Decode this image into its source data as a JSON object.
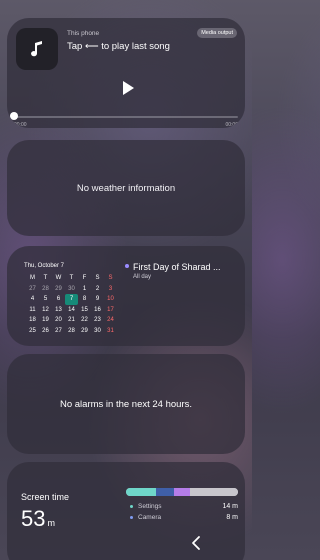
{
  "media": {
    "source": "This phone",
    "title": "Tap ⟵ to play last song",
    "output_label": "Media output",
    "time_start": "00:00",
    "time_end": "00:00",
    "progress": 0
  },
  "weather": {
    "message": "No weather information"
  },
  "calendar": {
    "date_label": "Thu, October 7",
    "weekdays": [
      "M",
      "T",
      "W",
      "T",
      "F",
      "S",
      "S"
    ],
    "weeks": [
      [
        "27",
        "28",
        "29",
        "30",
        "1",
        "2",
        "3"
      ],
      [
        "4",
        "5",
        "6",
        "7",
        "8",
        "9",
        "10"
      ],
      [
        "11",
        "12",
        "13",
        "14",
        "15",
        "16",
        "17"
      ],
      [
        "18",
        "19",
        "20",
        "21",
        "22",
        "23",
        "24"
      ],
      [
        "25",
        "26",
        "27",
        "28",
        "29",
        "30",
        "31"
      ]
    ],
    "today": "7",
    "event": {
      "title": "First Day of Sharad ...",
      "time": "All day",
      "color": "#9a8cff"
    }
  },
  "alarms": {
    "message": "No alarms in the next 24 hours."
  },
  "screen_time": {
    "label": "Screen time",
    "value": "53",
    "unit": "m",
    "segments": [
      {
        "color": "#6fd6c9",
        "fraction": 0.27
      },
      {
        "color": "#3f5fa8",
        "fraction": 0.16
      },
      {
        "color": "#b57de8",
        "fraction": 0.14
      },
      {
        "color": "#c8c6cc",
        "fraction": 0.43
      }
    ],
    "apps": [
      {
        "name": "Settings",
        "value": "14 m",
        "color": "#6fd6c9"
      },
      {
        "name": "Camera",
        "value": "8 m",
        "color": "#7f9bf0"
      }
    ]
  },
  "nav": {
    "back_icon": "chevron-left-icon"
  }
}
